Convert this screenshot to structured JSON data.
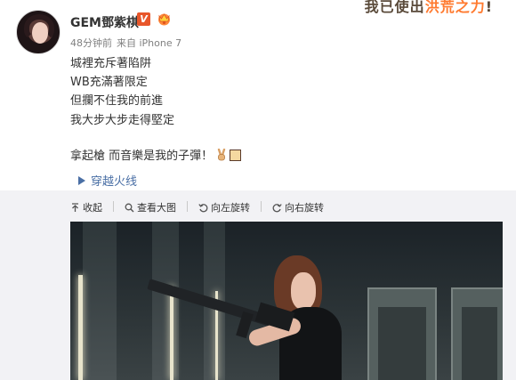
{
  "banner": {
    "text_before": "我已使出",
    "text_highlight": "洪荒之力",
    "text_after": "!"
  },
  "user": {
    "name": "GEM鄧紫棋",
    "badge": "V",
    "time": "48分钟前",
    "source": "来自 iPhone 7"
  },
  "post": {
    "lines": [
      "城裡充斥著陷阱",
      "WB充滿著限定",
      "但攔不住我的前進",
      "我大步大步走得堅定"
    ],
    "last_line": "拿起槍  而音樂是我的子彈！"
  },
  "music": {
    "label": "穿越火线"
  },
  "toolbar": {
    "collapse": "收起",
    "view_large": "查看大图",
    "rotate_left": "向左旋转",
    "rotate_right": "向右旋转"
  },
  "colors": {
    "link": "#4a6fa5",
    "badge": "#e8562a",
    "highlight": "#ff7a2f"
  },
  "icons": [
    "v-badge-icon",
    "crown-icon",
    "victory-hand-icon",
    "play-icon",
    "collapse-icon",
    "search-icon",
    "rotate-left-icon",
    "rotate-right-icon"
  ]
}
